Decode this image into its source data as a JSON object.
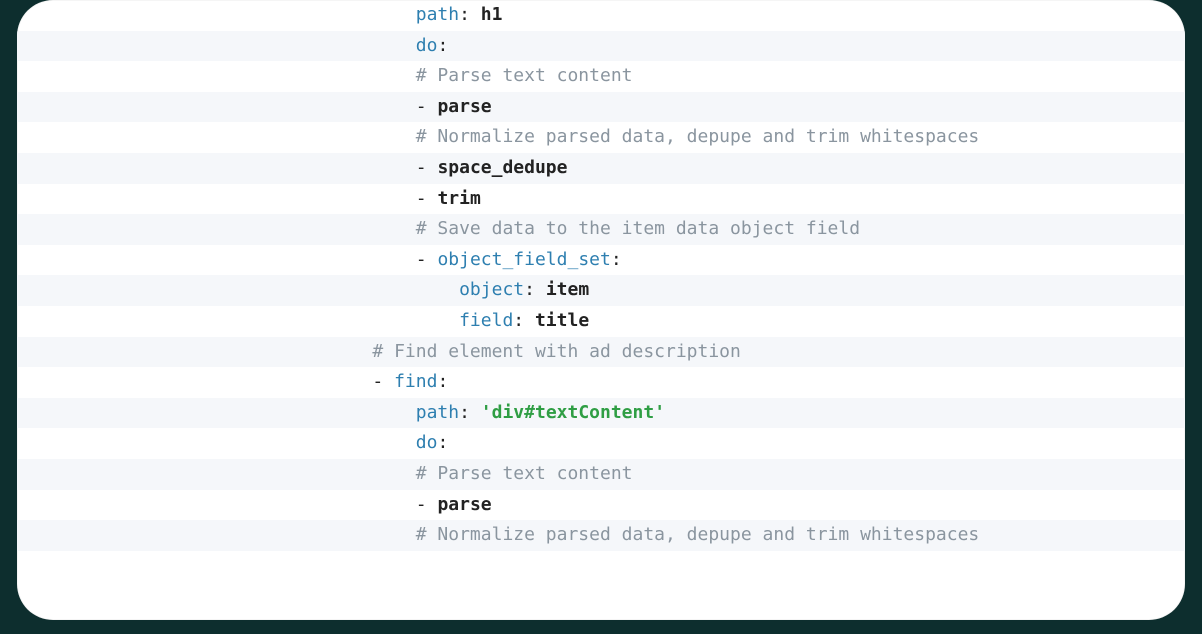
{
  "lines": {
    "l1": {
      "indent": "                    ",
      "key": "path",
      "punct": ": ",
      "val": "h1"
    },
    "l2": {
      "indent": "                    ",
      "key": "do",
      "punct": ":"
    },
    "l3": {
      "indent": "                    ",
      "cmt": "# Parse text content"
    },
    "l4": {
      "indent": "                    ",
      "dash": "- ",
      "val": "parse"
    },
    "l5": {
      "indent": "                    ",
      "cmt": "# Normalize parsed data, depupe and trim whitespaces"
    },
    "l6": {
      "indent": "                    ",
      "dash": "- ",
      "val": "space_dedupe"
    },
    "l7": {
      "indent": "                    ",
      "dash": "- ",
      "val": "trim"
    },
    "l8": {
      "indent": "                    ",
      "cmt": "# Save data to the item data object field"
    },
    "l9": {
      "indent": "                    ",
      "dash": "- ",
      "key": "object_field_set",
      "punct": ":"
    },
    "l10": {
      "indent": "                        ",
      "key": "object",
      "punct": ": ",
      "val": "item"
    },
    "l11": {
      "indent": "                        ",
      "key": "field",
      "punct": ": ",
      "val": "title"
    },
    "l12": {
      "indent": "                ",
      "cmt": "# Find element with ad description"
    },
    "l13": {
      "indent": "                ",
      "dash": "- ",
      "key": "find",
      "punct": ":"
    },
    "l14": {
      "indent": "                    ",
      "key": "path",
      "punct": ": ",
      "str": "'div#textContent'"
    },
    "l15": {
      "indent": "                    ",
      "key": "do",
      "punct": ":"
    },
    "l16": {
      "indent": "                    ",
      "cmt": "# Parse text content"
    },
    "l17": {
      "indent": "                    ",
      "dash": "- ",
      "val": "parse"
    },
    "l18": {
      "indent": "                    ",
      "cmt": "# Normalize parsed data, depupe and trim whitespaces"
    }
  }
}
